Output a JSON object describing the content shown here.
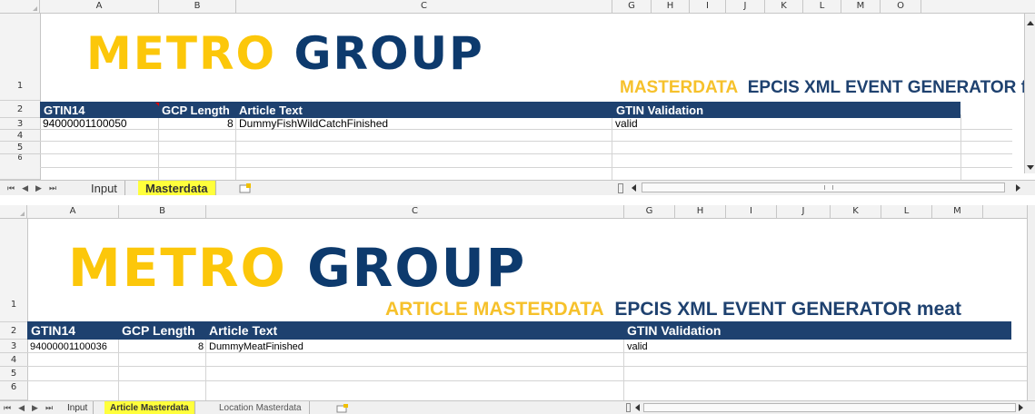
{
  "top": {
    "col_headers": [
      "A",
      "B",
      "C",
      "G",
      "H",
      "I",
      "J",
      "K",
      "L",
      "M",
      "O"
    ],
    "row_headers": [
      "1",
      "2",
      "3",
      "4",
      "5",
      "6"
    ],
    "logo": {
      "metro": "METRO",
      "group": "GROUP"
    },
    "title_yellow": "MASTERDATA",
    "title_blue": "EPCIS XML EVENT GENERATOR fish",
    "headers": {
      "gtin": "GTIN14",
      "gcp": "GCP Length",
      "article": "Article Text",
      "validation": "GTIN Validation"
    },
    "row3": {
      "gtin": "94000001100050",
      "gcp": "8",
      "article": "DummyFishWildCatchFinished",
      "validation": "valid"
    },
    "tabs": {
      "input": "Input",
      "masterdata": "Masterdata"
    },
    "nav": [
      "⏮",
      "◀",
      "▶",
      "⏭"
    ]
  },
  "bottom": {
    "col_headers": [
      "A",
      "B",
      "C",
      "G",
      "H",
      "I",
      "J",
      "K",
      "L",
      "M"
    ],
    "row_headers": [
      "1",
      "2",
      "3",
      "4",
      "5",
      "6"
    ],
    "logo": {
      "metro": "METRO",
      "group": "GROUP"
    },
    "title_yellow": "ARTICLE MASTERDATA",
    "title_blue": "EPCIS XML EVENT GENERATOR meat",
    "headers": {
      "gtin": "GTIN14",
      "gcp": "GCP Length",
      "article": "Article Text",
      "validation": "GTIN Validation"
    },
    "row3": {
      "gtin": "94000001100036",
      "gcp": "8",
      "article": "DummyMeatFinished",
      "validation": "valid"
    },
    "tabs": {
      "input": "Input",
      "article": "Article Masterdata",
      "location": "Location Masterdata"
    },
    "nav": [
      "⏮",
      "◀",
      "▶",
      "⏭"
    ]
  },
  "colors": {
    "header_band": "#1e416f",
    "logo_yellow": "#fcc70a",
    "logo_blue": "#0d3a6d",
    "active_tab": "#ffff3c"
  }
}
